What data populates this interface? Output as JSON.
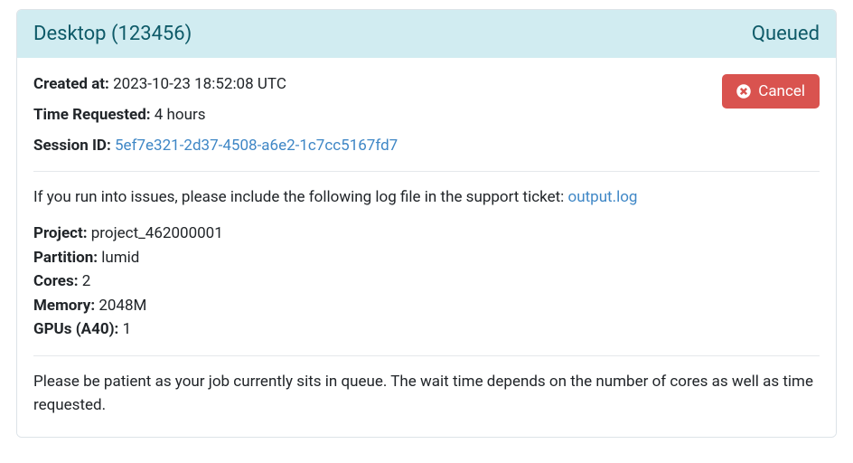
{
  "header": {
    "title": "Desktop (123456)",
    "status": "Queued"
  },
  "meta": {
    "created_at_label": "Created at:",
    "created_at_value": "2023-10-23 18:52:08 UTC",
    "time_requested_label": "Time Requested:",
    "time_requested_value": "4 hours",
    "session_id_label": "Session ID:",
    "session_id_value": "5ef7e321-2d37-4508-a6e2-1c7cc5167fd7"
  },
  "cancel": {
    "label": "Cancel"
  },
  "log": {
    "prefix": "If you run into issues, please include the following log file in the support ticket: ",
    "filename": "output.log"
  },
  "details": {
    "project_label": "Project:",
    "project_value": "project_462000001",
    "partition_label": "Partition:",
    "partition_value": "lumid",
    "cores_label": "Cores:",
    "cores_value": "2",
    "memory_label": "Memory:",
    "memory_value": "2048M",
    "gpus_label": "GPUs (A40):",
    "gpus_value": "1"
  },
  "queue_message": "Please be patient as your job currently sits in queue. The wait time depends on the number of cores as well as time requested."
}
